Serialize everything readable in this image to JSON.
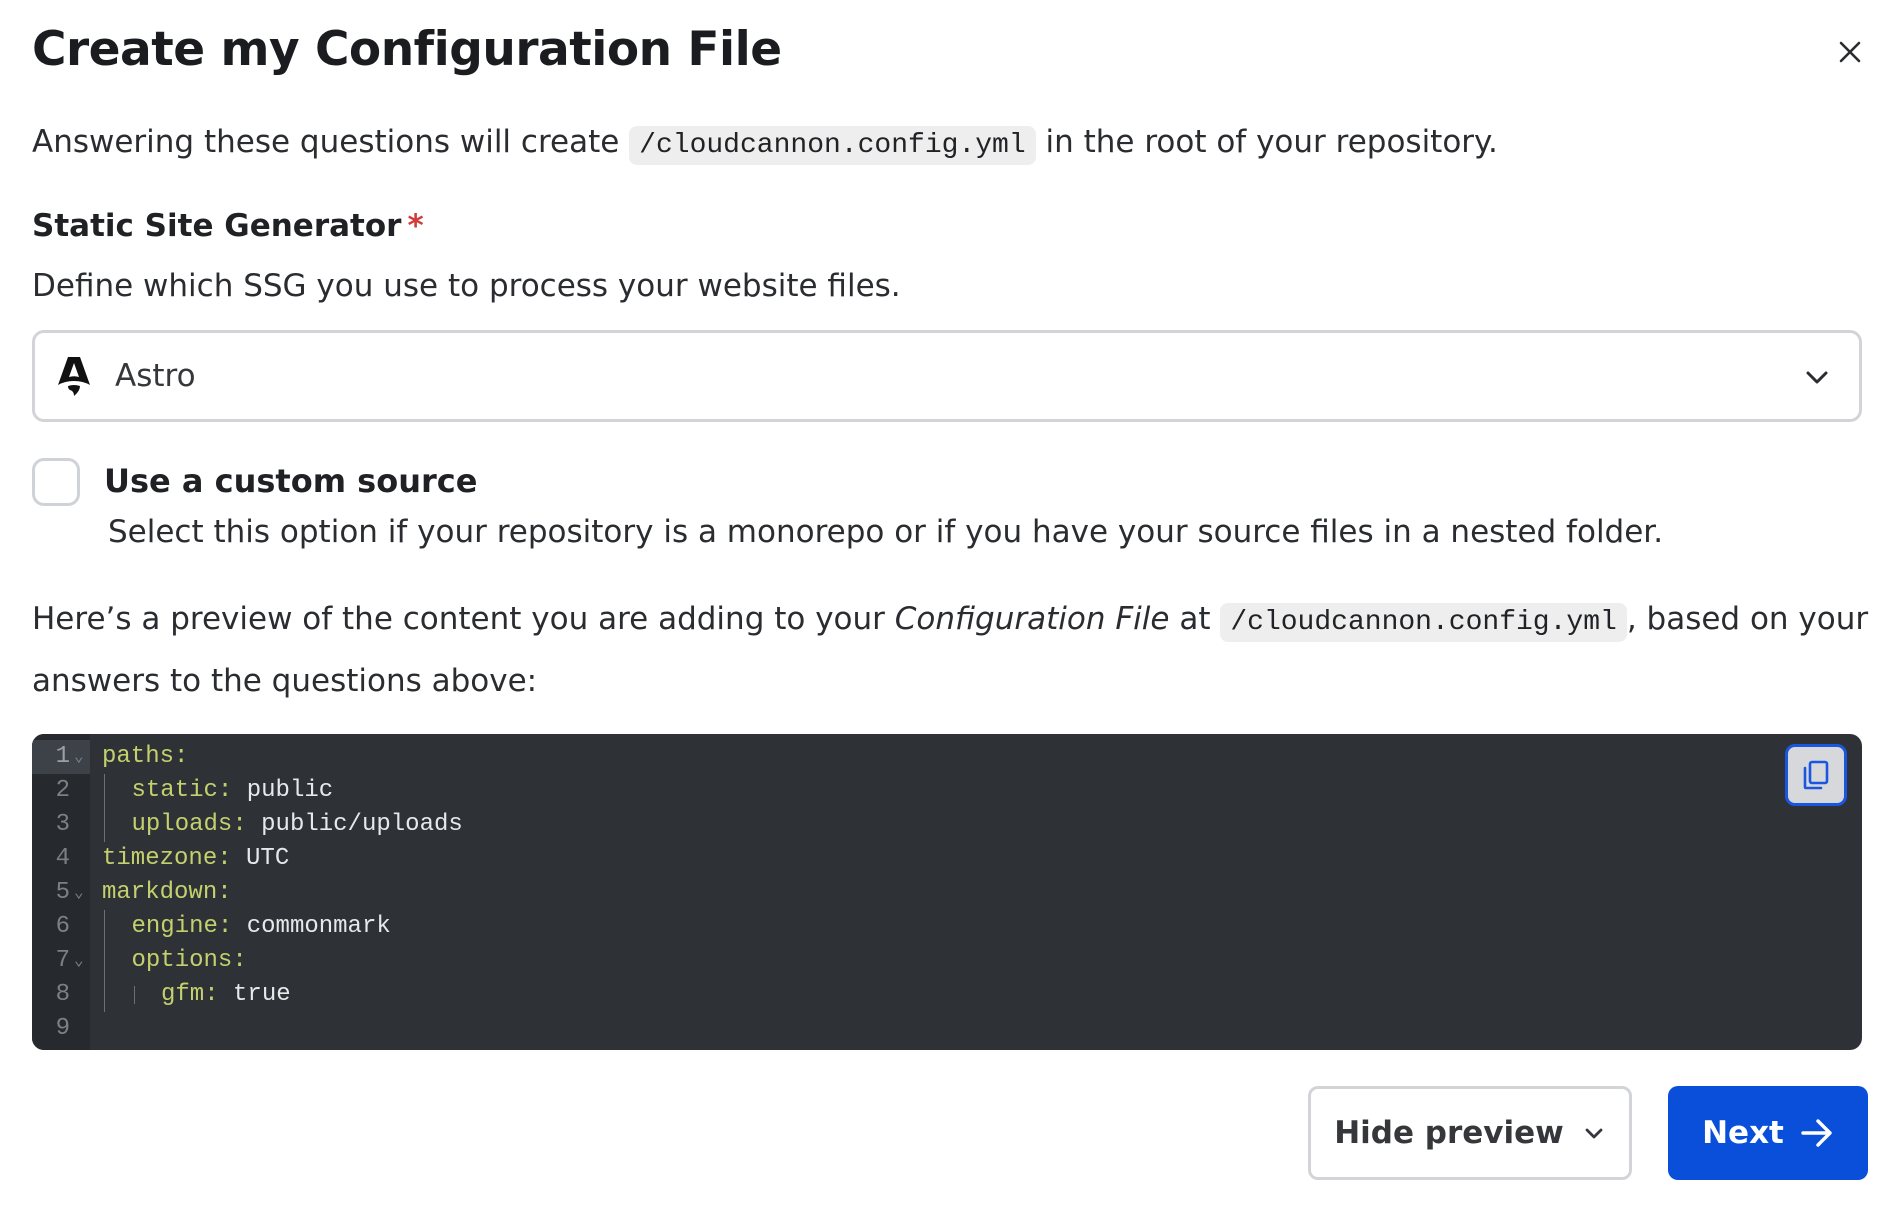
{
  "dialog": {
    "title": "Create my Configuration File",
    "intro": {
      "before": "Answering these questions will create ",
      "code": "/cloudcannon.config.yml",
      "after": " in the root of your repository."
    }
  },
  "ssg_field": {
    "label": "Static Site Generator",
    "required_marker": "*",
    "help": "Define which SSG you use to process your website files.",
    "selected": "Astro",
    "selected_icon": "astro-logo-icon"
  },
  "custom_source": {
    "checked": false,
    "label": "Use a custom source",
    "help": "Select this option if your repository is a monorepo or if you have your source files in a nested folder."
  },
  "preview": {
    "text_before": "Here’s a preview of the content you are adding to your ",
    "text_em": "Configuration File",
    "text_mid": " at ",
    "code": "/cloudcannon.config.yml",
    "text_after": ", based on your answers to the questions above:"
  },
  "code_preview": {
    "lines": [
      {
        "num": "1",
        "fold": "⌄",
        "key": "paths",
        "sep": ":",
        "value": ""
      },
      {
        "num": "2",
        "fold": "",
        "key": "static",
        "sep": ": ",
        "value": "public"
      },
      {
        "num": "3",
        "fold": "",
        "key": "uploads",
        "sep": ": ",
        "value": "public/uploads"
      },
      {
        "num": "4",
        "fold": "",
        "key": "timezone",
        "sep": ": ",
        "value": "UTC"
      },
      {
        "num": "5",
        "fold": "⌄",
        "key": "markdown",
        "sep": ":",
        "value": ""
      },
      {
        "num": "6",
        "fold": "",
        "key": "engine",
        "sep": ": ",
        "value": "commonmark"
      },
      {
        "num": "7",
        "fold": "⌄",
        "key": "options",
        "sep": ":",
        "value": ""
      },
      {
        "num": "8",
        "fold": "",
        "key": "gfm",
        "sep": ": ",
        "value": "true"
      },
      {
        "num": "9",
        "fold": "",
        "key": "",
        "sep": "",
        "value": ""
      }
    ],
    "copy_icon": "copy-icon"
  },
  "footer": {
    "hide_preview_label": "Hide preview",
    "next_label": "Next"
  },
  "colors": {
    "primary": "#0a4fd9",
    "required": "#d03b3b",
    "code_bg": "#2e3236",
    "code_key": "#c3d06d"
  }
}
